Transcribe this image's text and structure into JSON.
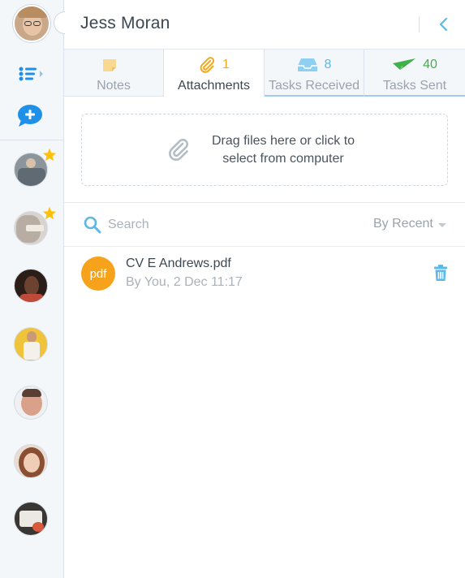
{
  "header": {
    "title": "Jess Moran"
  },
  "tabs": [
    {
      "label": "Notes",
      "count": "",
      "icon": "note-icon",
      "color": "#f5c66b"
    },
    {
      "label": "Attachments",
      "count": "1",
      "icon": "paperclip-icon",
      "color": "#f0a81e"
    },
    {
      "label": "Tasks Received",
      "count": "8",
      "icon": "inbox-tray-icon",
      "color": "#5bb8e8"
    },
    {
      "label": "Tasks Sent",
      "count": "40",
      "icon": "paper-plane-icon",
      "color": "#3fb24a"
    }
  ],
  "dropzone": {
    "line1": "Drag files here or click to",
    "line2": "select from computer"
  },
  "search": {
    "placeholder": "Search",
    "sort_label": "By Recent"
  },
  "files": [
    {
      "badge": "pdf",
      "name": "CV E Andrews.pdf",
      "meta": "By You, 2 Dec 11:17"
    }
  ],
  "colors": {
    "accent_blue": "#5bb8e8",
    "pdf_orange": "#f7a21b",
    "star_yellow": "#ffc107",
    "chat_blue": "#1e90e8"
  },
  "sidebar": {
    "contacts": [
      {
        "name": "contact-1",
        "starred": true
      },
      {
        "name": "contact-2",
        "starred": true
      },
      {
        "name": "contact-3",
        "starred": false
      },
      {
        "name": "contact-4",
        "starred": false
      },
      {
        "name": "contact-5",
        "starred": false
      },
      {
        "name": "contact-6",
        "starred": false
      },
      {
        "name": "contact-7",
        "starred": false
      }
    ]
  }
}
